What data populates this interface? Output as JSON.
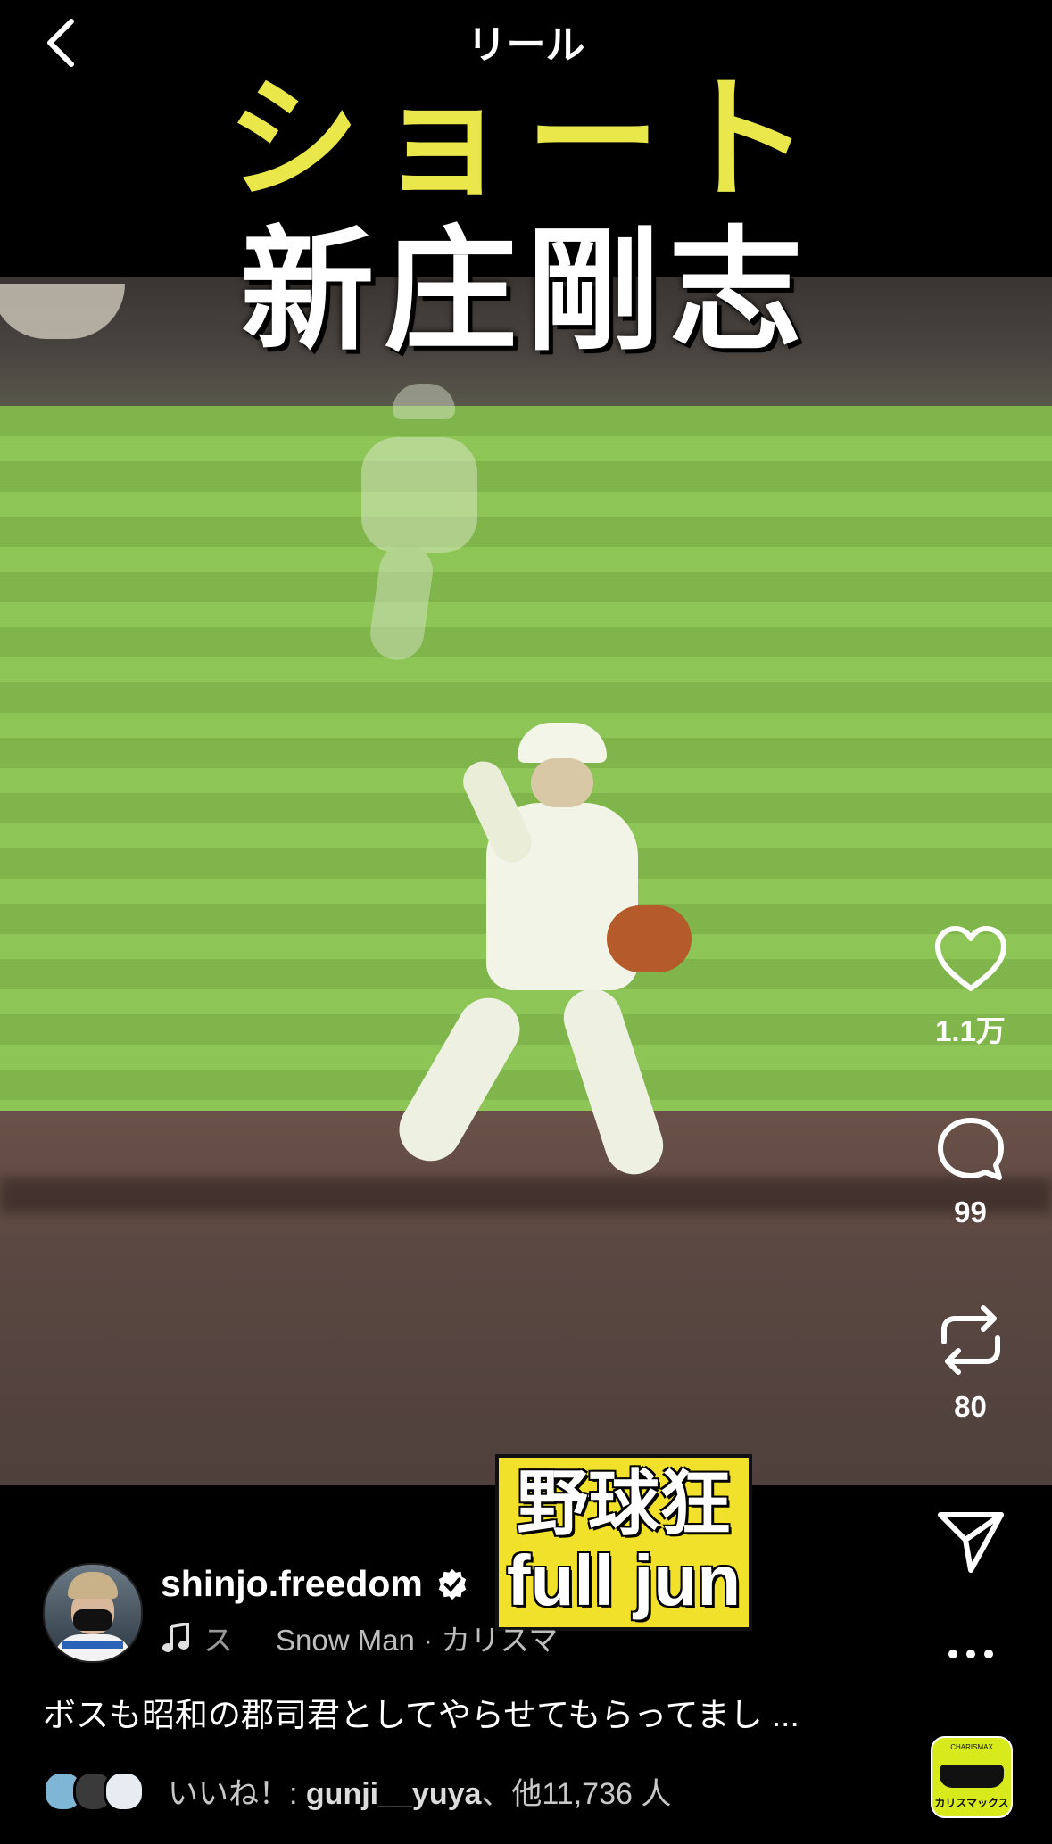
{
  "header": {
    "title": "リール",
    "back_icon": "chevron-left-icon"
  },
  "video_overlay": {
    "title_line1": "ショート",
    "title_line2": "新庄剛志",
    "badge_line1": "野球狂",
    "badge_line2": "full jun",
    "title_color": "#e9e74a",
    "badge_color": "#f2e12b"
  },
  "actions": {
    "like": {
      "icon": "heart-icon",
      "count": "1.1万"
    },
    "comment": {
      "icon": "comment-bubble-icon",
      "count": "99"
    },
    "repost": {
      "icon": "repost-icon",
      "count": "80"
    },
    "share": {
      "icon": "paper-plane-icon"
    },
    "more": {
      "icon": "more-dots-icon"
    }
  },
  "post": {
    "username": "shinjo.freedom",
    "verified": true,
    "audio_fragment": "ス",
    "audio_track": "Snow Man · カリスマ",
    "caption": "ボスも昭和の郡司君としてやらせてもらってまし ...",
    "likes_text": "いいね！: ",
    "likes_user": "gunji__yuya",
    "likes_rest": "、他11,736 人",
    "audio_thumb_label": "カリスマックス",
    "audio_thumb_top": "CHARISMAX"
  }
}
